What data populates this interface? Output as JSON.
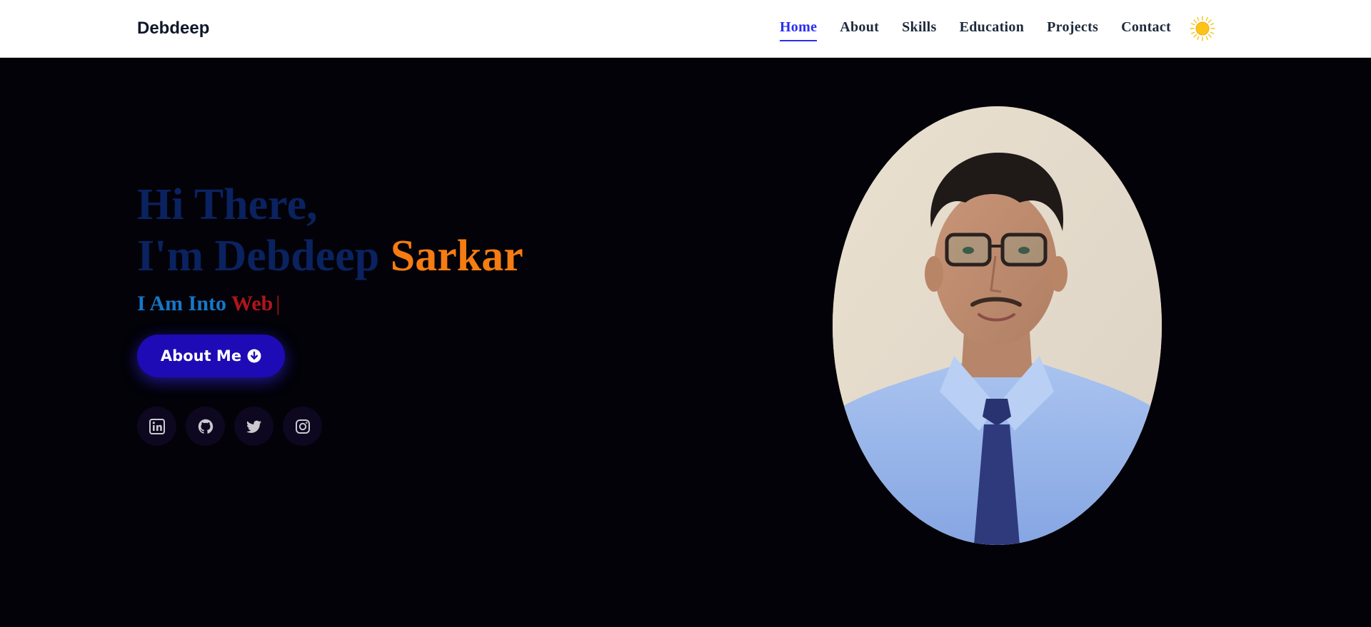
{
  "navbar": {
    "brand": "Debdeep",
    "links": [
      {
        "label": "Home",
        "active": true
      },
      {
        "label": "About"
      },
      {
        "label": "Skills"
      },
      {
        "label": "Education"
      },
      {
        "label": "Projects"
      },
      {
        "label": "Contact"
      }
    ],
    "theme_icon": "sun-icon"
  },
  "hero": {
    "greeting_line1": "Hi There,",
    "greeting_line2_first": "I'm Debdeep",
    "greeting_line2_last": "Sarkar",
    "typed_prefix": "I Am Into",
    "typed_word": "Web",
    "typed_cursor": "|",
    "about_button_label": "About Me",
    "about_button_icon": "arrow-down-circle-icon",
    "socials": [
      {
        "icon": "linkedin-icon"
      },
      {
        "icon": "github-icon"
      },
      {
        "icon": "twitter-icon"
      },
      {
        "icon": "instagram-icon"
      }
    ],
    "portrait": "profile-photo"
  },
  "colors": {
    "nav_active": "#2a2ef0",
    "greeting": "#0b2260",
    "surname": "#f57c12",
    "typed_prefix": "#1677c8",
    "typed_word": "#b1151a",
    "button_bg": "#1e0bb5",
    "hero_bg": "#020208"
  }
}
